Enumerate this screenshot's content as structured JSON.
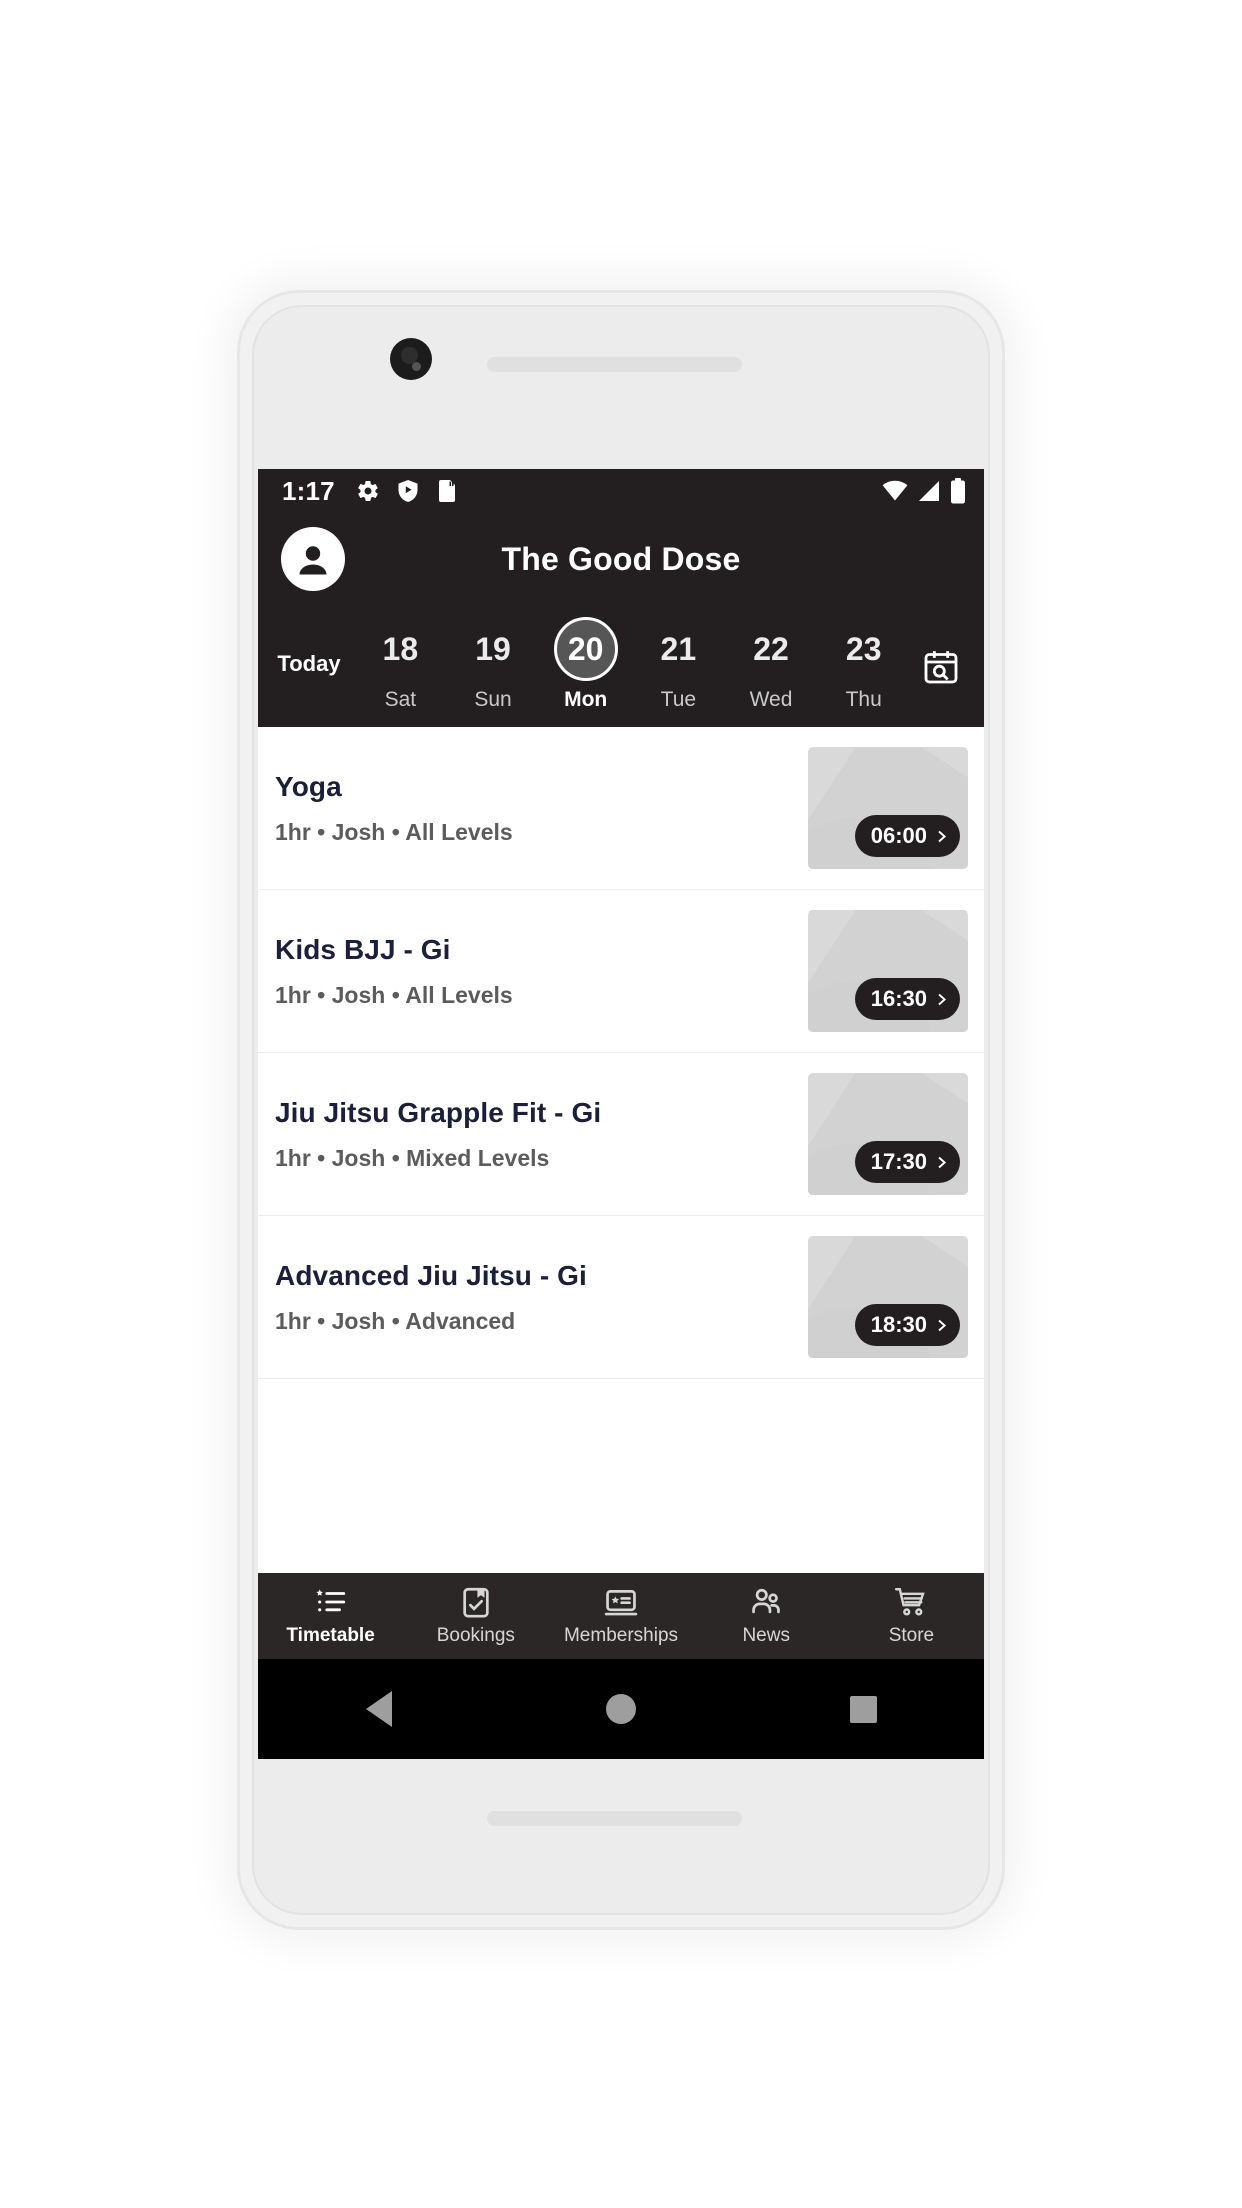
{
  "statusbar": {
    "time": "1:17",
    "left_icons": [
      "gear-icon",
      "shield-play-icon",
      "sd-card-icon"
    ],
    "right_icons": [
      "wifi-icon",
      "cellular-signal-icon",
      "battery-icon"
    ]
  },
  "header": {
    "title": "The Good Dose",
    "avatar_icon": "person-avatar-icon"
  },
  "datestrip": {
    "today_label": "Today",
    "calendar_icon": "calendar-search-icon",
    "days": [
      {
        "num": "18",
        "dow": "Sat",
        "selected": false
      },
      {
        "num": "19",
        "dow": "Sun",
        "selected": false
      },
      {
        "num": "20",
        "dow": "Mon",
        "selected": true
      },
      {
        "num": "21",
        "dow": "Tue",
        "selected": false
      },
      {
        "num": "22",
        "dow": "Wed",
        "selected": false
      },
      {
        "num": "23",
        "dow": "Thu",
        "selected": false
      }
    ]
  },
  "classes": [
    {
      "title": "Yoga",
      "meta": "1hr • Josh • All Levels",
      "time": "06:00"
    },
    {
      "title": "Kids BJJ - Gi",
      "meta": "1hr • Josh • All Levels",
      "time": "16:30"
    },
    {
      "title": "Jiu Jitsu Grapple Fit - Gi",
      "meta": "1hr • Josh • Mixed Levels",
      "time": "17:30"
    },
    {
      "title": "Advanced Jiu Jitsu - Gi",
      "meta": "1hr • Josh • Advanced",
      "time": "18:30"
    }
  ],
  "bottom_nav": [
    {
      "label": "Timetable",
      "icon": "list-star-icon",
      "active": true
    },
    {
      "label": "Bookings",
      "icon": "clipboard-check-icon",
      "active": false
    },
    {
      "label": "Memberships",
      "icon": "membership-card-icon",
      "active": false
    },
    {
      "label": "News",
      "icon": "people-icon",
      "active": false
    },
    {
      "label": "Store",
      "icon": "shopping-cart-icon",
      "active": false
    }
  ],
  "system_nav": [
    {
      "name": "back-button"
    },
    {
      "name": "home-button"
    },
    {
      "name": "recents-button"
    }
  ],
  "colors": {
    "header_bg": "#231f20",
    "nav_bg": "#2b2727",
    "title_text": "#1b1f3b",
    "meta_text": "#5c5c5c",
    "thumb_bg": "#d9d9d9"
  }
}
